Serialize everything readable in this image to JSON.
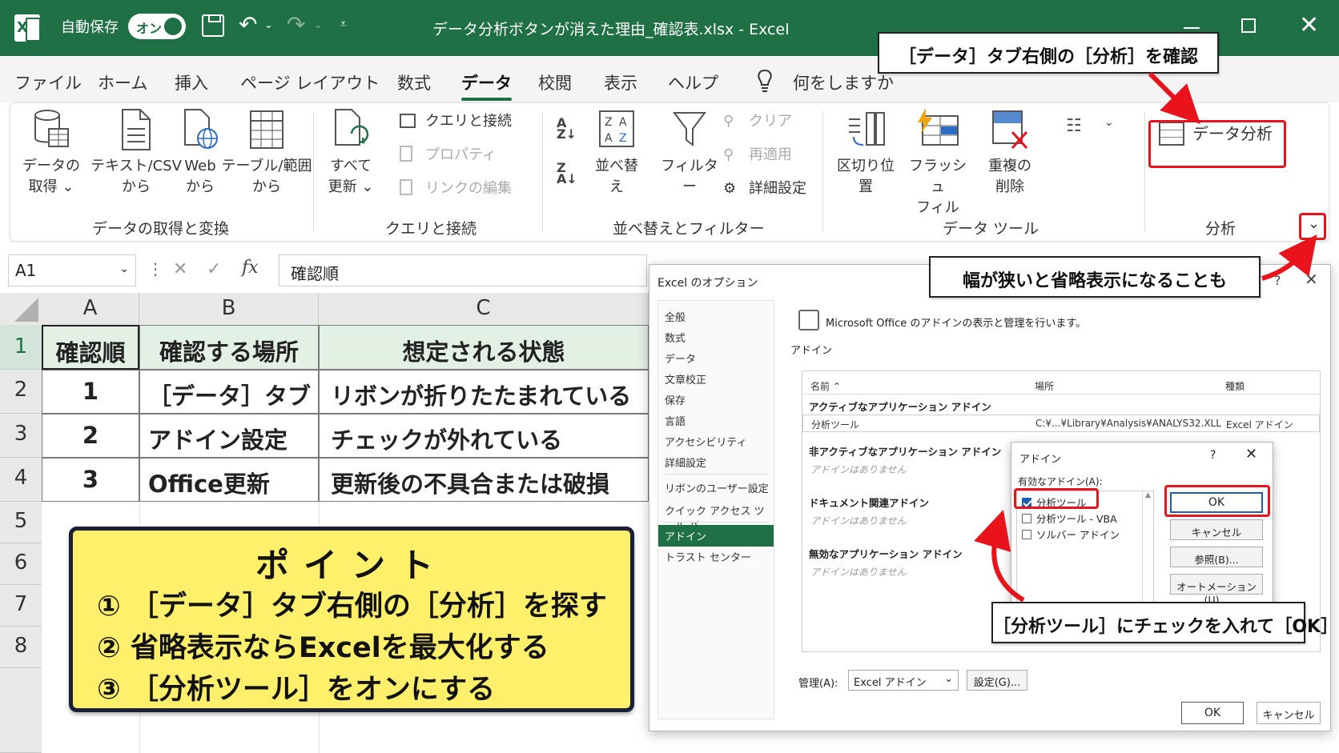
{
  "titlebar": {
    "autosave_label": "自動保存",
    "autosave_toggle": "オン",
    "title": "データ分析ボタンが消えた理由_確認表.xlsx  -  Excel"
  },
  "menu": {
    "tabs": [
      "ファイル",
      "ホーム",
      "挿入",
      "ページ レイアウト",
      "数式",
      "データ",
      "校閲",
      "表示",
      "ヘルプ"
    ],
    "search": "何をしますか"
  },
  "ribbon": {
    "get_data_1": "データの",
    "get_data_2": "取得 ⌄",
    "text_csv_1": "テキスト/CSV",
    "text_csv_2": "から",
    "web_1": "Web",
    "web_2": "から",
    "table_1": "テーブル/範囲",
    "table_2": "から",
    "refresh_1": "すべて",
    "refresh_2": "更新 ⌄",
    "queries": "クエリと接続",
    "properties": "プロパティ",
    "edit_links": "リンクの編集",
    "sort": "並べ替え",
    "filter": "フィルター",
    "clear": "クリア",
    "reapply": "再適用",
    "advanced": "詳細設定",
    "text_to_col": "区切り位置",
    "flash_fill_1": "フラッシュ",
    "flash_fill_2": "フィル",
    "remove_dup_1": "重複の",
    "remove_dup_2": "削除",
    "data_analysis": "データ分析",
    "groups": {
      "get_transform": "データの取得と変換",
      "queries": "クエリと接続",
      "sort_filter": "並べ替えとフィルター",
      "data_tools": "データ ツール",
      "analysis": "分析"
    }
  },
  "formula_bar": {
    "namebox": "A1",
    "content": "確認順"
  },
  "sheet": {
    "columns": [
      "A",
      "B",
      "C"
    ],
    "rows": [
      "1",
      "2",
      "3",
      "4",
      "5",
      "6",
      "7",
      "8"
    ],
    "header": [
      "確認順",
      "確認する場所",
      "想定される状態"
    ],
    "data": [
      [
        "1",
        "［データ］タブ",
        "リボンが折りたたまれている"
      ],
      [
        "2",
        "アドイン設定",
        "チェックが外れている"
      ],
      [
        "3",
        "Office更新",
        "更新後の不具合または破損"
      ]
    ]
  },
  "point": {
    "title": "ポイント",
    "lines": [
      "① ［データ］タブ右側の［分析］を探す",
      "② 省略表示ならExcelを最大化する",
      "③ ［分析ツール］をオンにする"
    ]
  },
  "options_dialog": {
    "title": "Excel のオプション",
    "nav": [
      "全般",
      "数式",
      "データ",
      "文章校正",
      "保存",
      "言語",
      "アクセシビリティ",
      "詳細設定",
      "リボンのユーザー設定",
      "クイック アクセス ツール バー",
      "アドイン",
      "トラスト センター"
    ],
    "description": "Microsoft Office のアドインの表示と管理を行います。",
    "section": "アドイン",
    "col_name": "名前 ⌃",
    "col_location": "場所",
    "col_type": "種類",
    "active_group": "アクティブなアプリケーション アドイン",
    "active_row": {
      "name": "分析ツール",
      "location": "C:¥...¥Library¥Analysis¥ANALYS32.XLL",
      "type": "Excel アドイン"
    },
    "inactive_group": "非アクティブなアプリケーション アドイン",
    "doc_group": "ドキュメント関連アドイン",
    "disabled_group": "無効なアプリケーション アドイン",
    "none": "アドインはありません",
    "manage_label": "管理(A):",
    "manage_value": "Excel アドイン",
    "go_button": "設定(G)...",
    "ok": "OK",
    "cancel": "キャンセル"
  },
  "addin_dialog": {
    "title": "アドイン",
    "available_label": "有効なアドイン(A):",
    "items": [
      {
        "label": "分析ツール",
        "checked": true
      },
      {
        "label": "分析ツール - VBA",
        "checked": false
      },
      {
        "label": "ソルバー アドイン",
        "checked": false
      }
    ],
    "ok": "OK",
    "cancel": "キャンセル",
    "browse": "参照(B)...",
    "automation": "オートメーション(U)..."
  },
  "callouts": {
    "top": "［データ］タブ右側の［分析］を確認",
    "middle": "幅が狭いと省略表示になることも",
    "bottom": "［分析ツール］にチェックを入れて［OK］"
  },
  "colors": {
    "excel_green": "#1f7145",
    "highlight_red": "#e8131b",
    "point_yellow": "#fef06a"
  }
}
